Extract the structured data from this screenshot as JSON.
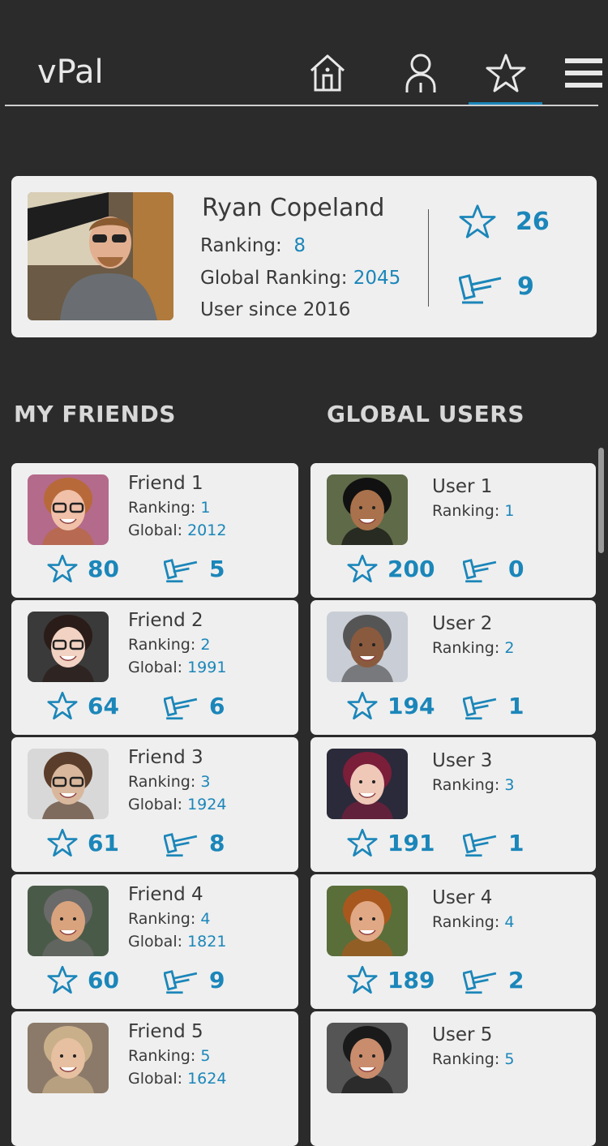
{
  "header": {
    "title": "vPal",
    "nav": [
      {
        "name": "home-icon"
      },
      {
        "name": "profile-icon"
      },
      {
        "name": "star-icon",
        "active": true
      },
      {
        "name": "menu-icon"
      }
    ]
  },
  "profile": {
    "name": "Ryan Copeland",
    "ranking_label": "Ranking:",
    "ranking_value": "8",
    "global_label": "Global Ranking:",
    "global_value": "2045",
    "since": "User since 2016",
    "stars": "26",
    "gavels": "9"
  },
  "sections": {
    "friends_title": "MY FRIENDS",
    "global_title": "GLOBAL USERS"
  },
  "labels": {
    "ranking": "Ranking:",
    "global": "Global:"
  },
  "friends": [
    {
      "name": "Friend 1",
      "ranking": "1",
      "global": "2012",
      "stars": "80",
      "gavels": "5"
    },
    {
      "name": "Friend 2",
      "ranking": "2",
      "global": "1991",
      "stars": "64",
      "gavels": "6"
    },
    {
      "name": "Friend 3",
      "ranking": "3",
      "global": "1924",
      "stars": "61",
      "gavels": "8"
    },
    {
      "name": "Friend 4",
      "ranking": "4",
      "global": "1821",
      "stars": "60",
      "gavels": "9"
    },
    {
      "name": "Friend 5",
      "ranking": "5",
      "global": "1624",
      "stars": "",
      "gavels": ""
    }
  ],
  "global_users": [
    {
      "name": "User 1",
      "ranking": "1",
      "stars": "200",
      "gavels": "0"
    },
    {
      "name": "User 2",
      "ranking": "2",
      "stars": "194",
      "gavels": "1"
    },
    {
      "name": "User 3",
      "ranking": "3",
      "stars": "191",
      "gavels": "1"
    },
    {
      "name": "User 4",
      "ranking": "4",
      "stars": "189",
      "gavels": "2"
    },
    {
      "name": "User 5",
      "ranking": "5",
      "stars": "",
      "gavels": ""
    }
  ],
  "colors": {
    "accent": "#1b86b9",
    "background": "#2b2b2b",
    "card": "#efefef"
  }
}
